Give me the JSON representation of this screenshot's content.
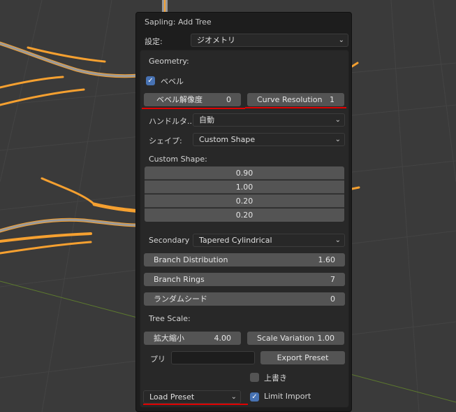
{
  "panel": {
    "title": "Sapling: Add Tree",
    "settings_label": "設定:",
    "settings_value": "ジオメトリ"
  },
  "geometry": {
    "header": "Geometry:",
    "bevel_label": "ベベル",
    "bevel_checked": true,
    "bevel_resolution_label": "ベベル解像度",
    "bevel_resolution_value": "0",
    "curve_resolution_label": "Curve Resolution",
    "curve_resolution_value": "1",
    "handle_type_label": "ハンドルタ..",
    "handle_type_value": "自動",
    "shape_label": "シェイプ:",
    "shape_value": "Custom Shape",
    "custom_shape_header": "Custom Shape:",
    "custom_shape_values": [
      "0.90",
      "1.00",
      "0.20",
      "0.20"
    ],
    "secondary_label": "Secondary ..",
    "secondary_value": "Tapered Cylindrical",
    "branch_distribution_label": "Branch Distribution",
    "branch_distribution_value": "1.60",
    "branch_rings_label": "Branch Rings",
    "branch_rings_value": "7",
    "random_seed_label": "ランダムシード",
    "random_seed_value": "0",
    "tree_scale_header": "Tree Scale:",
    "scale_label": "拡大縮小",
    "scale_value": "4.00",
    "scale_variation_label": "Scale Variation",
    "scale_variation_value": "1.00",
    "preset_label": "プリ",
    "preset_name_value": "",
    "export_preset_label": "Export Preset",
    "overwrite_label": "上書き",
    "overwrite_checked": false,
    "load_preset_label": "Load Preset",
    "limit_import_label": "Limit Import",
    "limit_import_checked": true
  },
  "colors": {
    "accent": "#4772b3",
    "annotation": "#e00000",
    "tree_outline": "#f5a030"
  }
}
